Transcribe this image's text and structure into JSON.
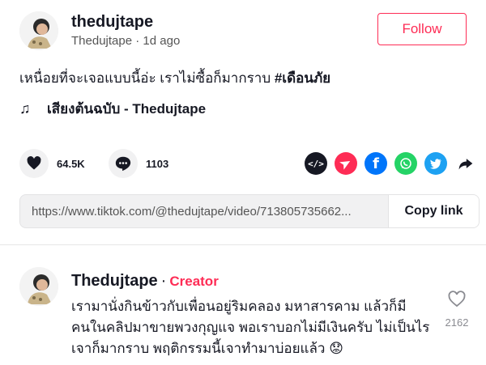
{
  "post": {
    "username": "thedujtape",
    "display_name": "Thedujtape",
    "time_ago": "1d ago",
    "follow_label": "Follow",
    "caption": "เหนื่อยที่จะเจอแบบนี้อ่ะ เราไม่ซื้อก็มากราบ",
    "hashtag": "#เดือนภัย",
    "music": "เสียงต้นฉบับ - Thedujtape"
  },
  "actions": {
    "likes": "64.5K",
    "comments": "1103",
    "icons": [
      "heart-icon",
      "comment-icon",
      "embed-icon",
      "send-icon",
      "facebook-icon",
      "whatsapp-icon",
      "twitter-icon",
      "share-arrow-icon"
    ],
    "colors": {
      "embed": "#161823",
      "send": "#fe2c55",
      "facebook": "#0075fa",
      "whatsapp": "#25d366",
      "twitter": "#1da1f2"
    }
  },
  "copy": {
    "url": "https://www.tiktok.com/@thedujtape/video/713805735662...",
    "button": "Copy link"
  },
  "comment": {
    "author": "Thedujtape",
    "separator": "·",
    "badge": "Creator",
    "text": "เรามานั่งกินข้าวกับเพื่อนอยู่ริมคลอง มหาสารคาม แล้วก็มีคนในคลิปมาขายพวงกุญแจ พอเราบอกไม่มีเงินครับ ไม่เป็นไร เจาก็มากราบ พฤติกรรมนี้เจาทำมาบ่อยแล้ว",
    "emoji": "😟",
    "likes": "2162"
  },
  "theme": {
    "accent": "#fe2c55"
  }
}
